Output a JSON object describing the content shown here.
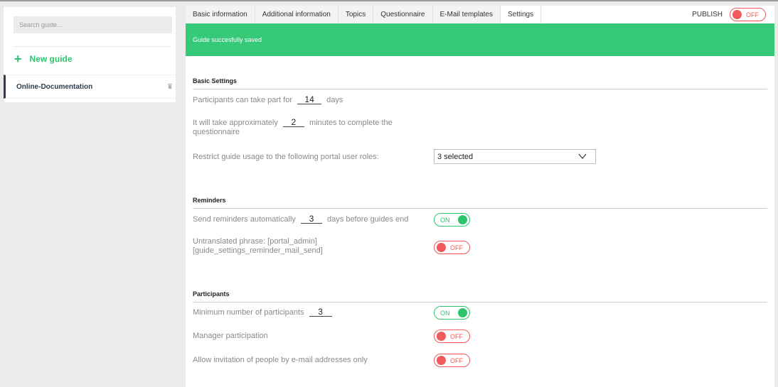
{
  "sidebar": {
    "search_placeholder": "Search guide...",
    "new_guide_plus": "+",
    "new_guide_label": "New guide",
    "guides": [
      {
        "name": "Online-Documentation"
      }
    ]
  },
  "tabs": [
    {
      "label": "Basic information"
    },
    {
      "label": "Additional information"
    },
    {
      "label": "Topics"
    },
    {
      "label": "Questionnaire"
    },
    {
      "label": "E-Mail templates"
    },
    {
      "label": "Settings",
      "active": true
    }
  ],
  "publish": {
    "label": "PUBLISH",
    "state": "OFF"
  },
  "banner": {
    "message": "Guide succesfully saved",
    "color": "#36c978"
  },
  "basic_settings": {
    "title": "Basic Settings",
    "participation_prefix": "Participants can take part for",
    "participation_days": "14",
    "participation_suffix": "days",
    "duration_prefix": "It will take approximately",
    "duration_minutes": "2",
    "duration_suffix_1": "minutes to complete the",
    "duration_suffix_2": "questionnaire",
    "roles_label": "Restrict guide usage to the following portal user roles:",
    "roles_selected": "3 selected"
  },
  "reminders": {
    "title": "Reminders",
    "send_prefix": "Send reminders automatically",
    "send_days": "3",
    "send_suffix": "days before guides end",
    "send_toggle": "ON",
    "untranslated_line1": "Untranslated phrase: [portal_admin]",
    "untranslated_line2": "[guide_settings_reminder_mail_send]",
    "untranslated_toggle": "OFF"
  },
  "participants": {
    "title": "Participants",
    "min_label": "Minimum number of participants",
    "min_value": "3",
    "min_toggle": "ON",
    "manager_label": "Manager participation",
    "manager_toggle": "OFF",
    "email_label": "Allow invitation of people by e-mail addresses only",
    "email_toggle": "OFF"
  },
  "colors": {
    "accent_green": "#2ec46e",
    "off_red": "#f05a5a",
    "nav_dark": "#2b3d4f"
  }
}
